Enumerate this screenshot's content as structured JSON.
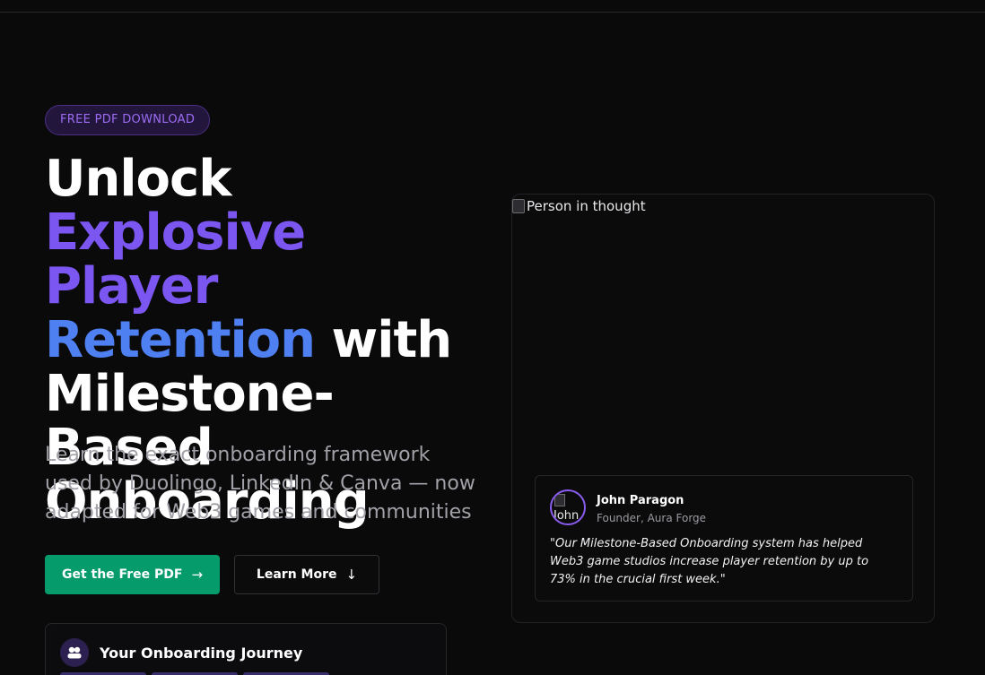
{
  "hero": {
    "badge": "FREE PDF DOWNLOAD",
    "headline_1": "Unlock",
    "headline_2": "Explosive Player",
    "headline_3": "Retention",
    "headline_4": " with",
    "headline_5": "Milestone-Based",
    "headline_6": "Onboarding",
    "subheading": "Learn the exact onboarding framework used by Duolingo, LinkedIn & Canva — now adapted for Web3 games and communities",
    "primary_cta": "Get the Free PDF",
    "secondary_cta": "Learn More"
  },
  "journey": {
    "title": "Your Onboarding Journey"
  },
  "testimonial_card": {
    "image_alt": "Person in thought",
    "avatar_alt": "John",
    "name": "John Paragon",
    "role": "Founder, Aura Forge",
    "quote": "\"Our Milestone-Based Onboarding system has helped Web3 game studios increase player retention by up to 73% in the crucial first week.\""
  },
  "icons": {
    "primary_cta_icon": "arrow-right-icon",
    "secondary_cta_icon": "arrow-down-icon",
    "journey_icon": "users-icon"
  },
  "colors": {
    "background": "#0a0a0b",
    "accent_purple": "#7c56f0",
    "accent_blue": "#4f80f2",
    "primary_button": "#069b6a"
  }
}
